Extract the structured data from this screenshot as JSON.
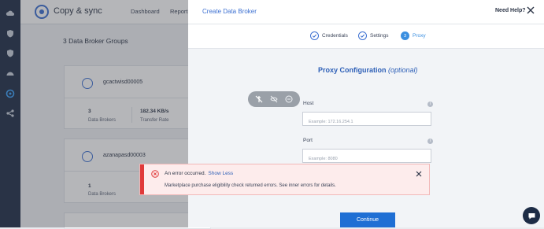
{
  "app": {
    "title": "Copy & sync",
    "nav": [
      "Dashboard",
      "Report"
    ],
    "groups_title": "3  Data Broker Groups",
    "cards": [
      {
        "name": "gcactwisd00005",
        "brokers_value": "3",
        "brokers_label": "Data Brokers",
        "rate_value": "182.34 KB/s",
        "rate_label": "Transfer Rate"
      },
      {
        "name": "azanapasd00003",
        "brokers_value": "1",
        "brokers_label": "Data Brokers",
        "rate_value": "",
        "rate_label": ""
      }
    ]
  },
  "modal": {
    "title": "Create Data Broker",
    "help": "Need Help?",
    "steps": [
      {
        "label": "Credentials",
        "state": "done"
      },
      {
        "label": "Settings",
        "state": "done"
      },
      {
        "label": "Proxy",
        "number": "3",
        "state": "active"
      }
    ],
    "section_title": "Proxy Configuration",
    "section_optional": "(optional)",
    "host": {
      "label": "Host",
      "placeholder": "Example: 172.16.254.1",
      "value": ""
    },
    "port": {
      "label": "Port",
      "placeholder": "Example: 8080",
      "value": ""
    },
    "continue_label": "Continue"
  },
  "error": {
    "title": "An error occurred.",
    "link": "Show Less",
    "message": "Marketplace purchase eligibility check returned errors. See inner errors for details."
  },
  "colors": {
    "accent": "#3b6fd1",
    "error": "#e03a3a",
    "rail": "#1d2c46",
    "primary_button": "#1f6fd4"
  }
}
